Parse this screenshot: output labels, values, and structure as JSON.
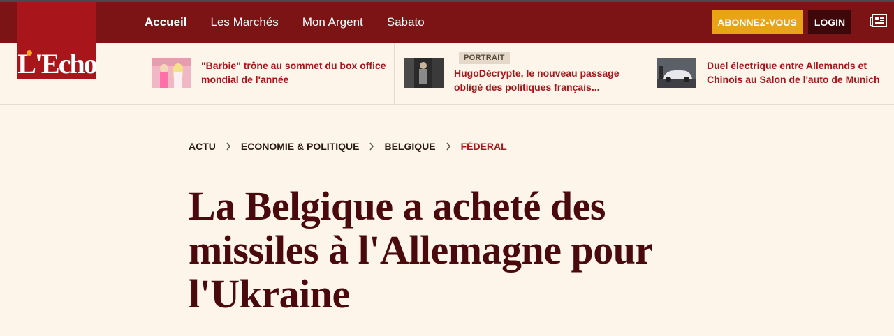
{
  "brand": {
    "logo_text": "L'Echo",
    "primary_color": "#7c1416",
    "accent_color": "#e8a317"
  },
  "nav": {
    "items": [
      {
        "label": "Accueil"
      },
      {
        "label": "Les Marchés"
      },
      {
        "label": "Mon Argent"
      },
      {
        "label": "Sabato"
      }
    ],
    "subscribe_label": "ABONNEZ-VOUS",
    "login_label": "LOGIN",
    "newspaper_icon": "newspaper-icon"
  },
  "teasers": [
    {
      "title": "\"Barbie\" trône au sommet du box office mondial de l'année",
      "badge": ""
    },
    {
      "title": "HugoDécrypte, le nouveau passage obligé des politiques français...",
      "badge": "PORTRAIT"
    },
    {
      "title": "Duel électrique entre Allemands et Chinois au Salon de l'auto de Munich",
      "badge": ""
    }
  ],
  "breadcrumb": [
    "ACTU",
    "ECONOMIE & POLITIQUE",
    "BELGIQUE",
    "FÉDERAL"
  ],
  "article": {
    "headline": "La Belgique a acheté des missiles à l'Allemagne pour l'Ukraine"
  }
}
